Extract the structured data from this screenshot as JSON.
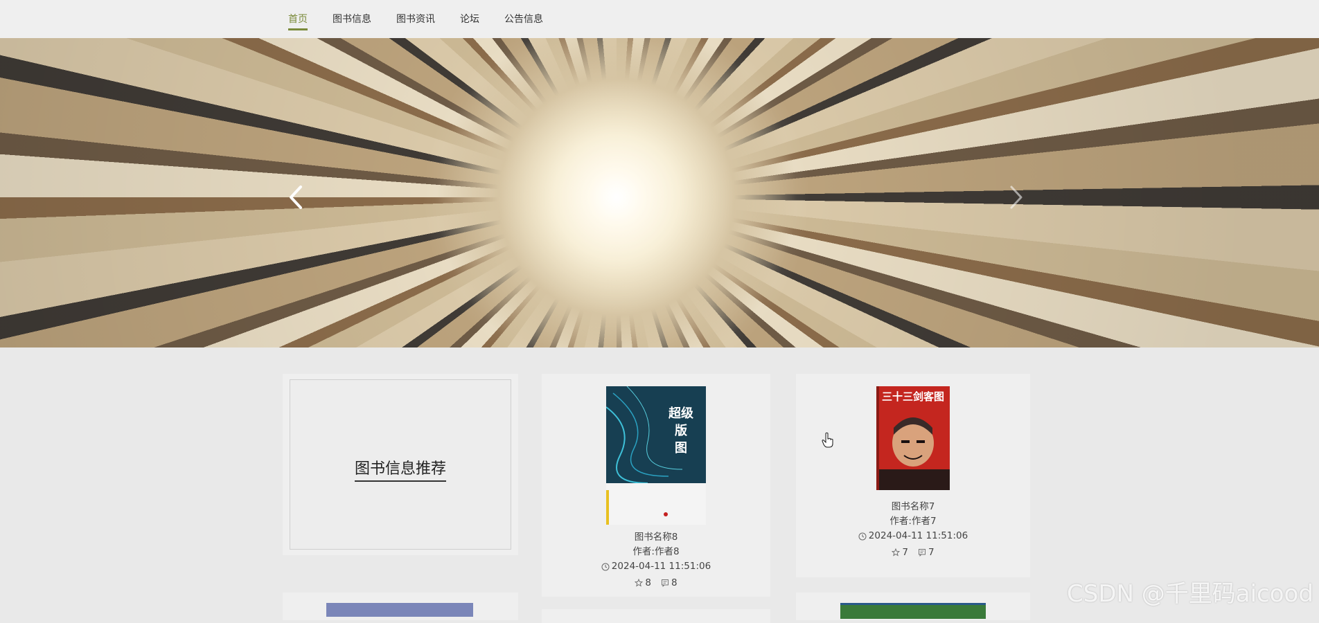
{
  "nav": {
    "items": [
      {
        "label": "首页",
        "active": true
      },
      {
        "label": "图书信息",
        "active": false
      },
      {
        "label": "图书资讯",
        "active": false
      },
      {
        "label": "论坛",
        "active": false
      },
      {
        "label": "公告信息",
        "active": false
      }
    ],
    "accent_color": "#7a8a3a"
  },
  "banner": {
    "slide_count": 3,
    "active_slide": 2,
    "prev_icon": "chevron-left-icon",
    "next_icon": "chevron-right-icon"
  },
  "recommend": {
    "title": "图书信息推荐"
  },
  "books": [
    {
      "name": "图书名称8",
      "author": "作者:作者8",
      "time": "2024-04-11 11:51:06",
      "likes": "8",
      "comments": "8",
      "cover_text": "超级版图",
      "cover_color": "#1d4a5e"
    },
    {
      "name": "图书名称7",
      "author": "作者:作者7",
      "time": "2024-04-11 11:51:06",
      "likes": "7",
      "comments": "7",
      "cover_text": "三十三剑客图",
      "cover_color": "#c4261f"
    }
  ],
  "watermark": "CSDN @千里码aicood"
}
